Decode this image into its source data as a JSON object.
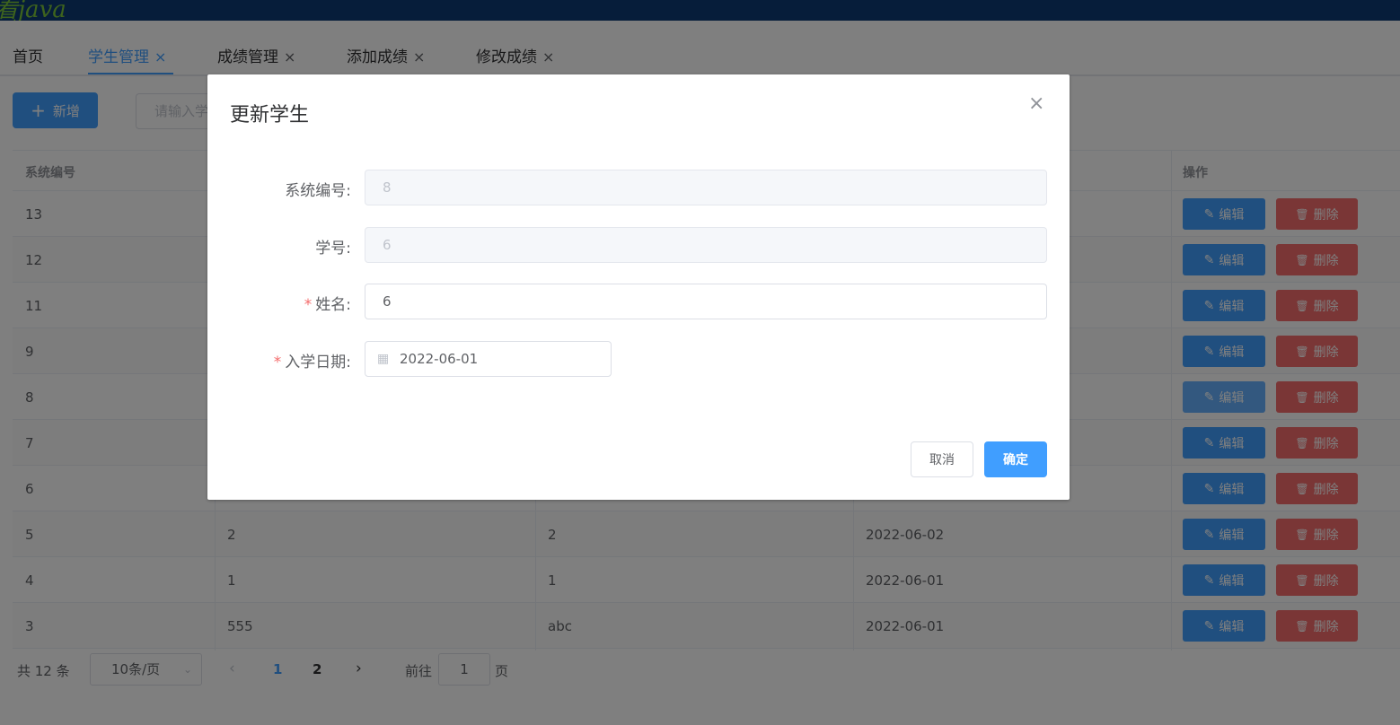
{
  "app": {
    "logo_text": "看java"
  },
  "tabs": [
    {
      "label": "首页",
      "closable": false
    },
    {
      "label": "学生管理",
      "closable": true,
      "active": true
    },
    {
      "label": "成绩管理",
      "closable": true
    },
    {
      "label": "添加成绩",
      "closable": true
    },
    {
      "label": "修改成绩",
      "closable": true
    }
  ],
  "icons": {
    "close": "×",
    "plus": "+",
    "edit": "✎",
    "delete": "🗑",
    "calendar": "▦",
    "chevron_down": "⌄",
    "prev": "‹",
    "next": "›"
  },
  "toolbar": {
    "add_label": "新增",
    "search_placeholder": "请输入学"
  },
  "table": {
    "columns": [
      "系统编号",
      "操作"
    ],
    "edit_label": "编辑",
    "delete_label": "删除",
    "rows": [
      {
        "id": "13",
        "student_no": "",
        "name": "",
        "date": ""
      },
      {
        "id": "12",
        "student_no": "",
        "name": "",
        "date": ""
      },
      {
        "id": "11",
        "student_no": "",
        "name": "",
        "date": ""
      },
      {
        "id": "9",
        "student_no": "",
        "name": "",
        "date": ""
      },
      {
        "id": "8",
        "student_no": "",
        "name": "",
        "date": ""
      },
      {
        "id": "7",
        "student_no": "",
        "name": "",
        "date": ""
      },
      {
        "id": "6",
        "student_no": "",
        "name": "",
        "date": ""
      },
      {
        "id": "5",
        "student_no": "2",
        "name": "2",
        "date": "2022-06-02"
      },
      {
        "id": "4",
        "student_no": "1",
        "name": "1",
        "date": "2022-06-01"
      },
      {
        "id": "3",
        "student_no": "555",
        "name": "abc",
        "date": "2022-06-01"
      }
    ]
  },
  "pagination": {
    "total_text": "共 12 条",
    "page_size": "10条/页",
    "pages": [
      "1",
      "2"
    ],
    "current_page": "1",
    "goto_label": "前往",
    "goto_value": "1",
    "page_word": "页"
  },
  "dialog": {
    "title": "更新学生",
    "fields": {
      "system_id": {
        "label": "系统编号:",
        "value": "8"
      },
      "student_no": {
        "label": "学号:",
        "value": "6"
      },
      "name": {
        "label": "姓名:",
        "value": "6",
        "required": "*"
      },
      "enroll_date": {
        "label": "入学日期:",
        "value": "2022-06-01",
        "required": "*"
      }
    },
    "cancel_label": "取消",
    "ok_label": "确定"
  },
  "colors": {
    "primary": "#409eff",
    "danger": "#f56c6c",
    "topbar": "#0d3a75",
    "logo": "#7dc73a"
  }
}
